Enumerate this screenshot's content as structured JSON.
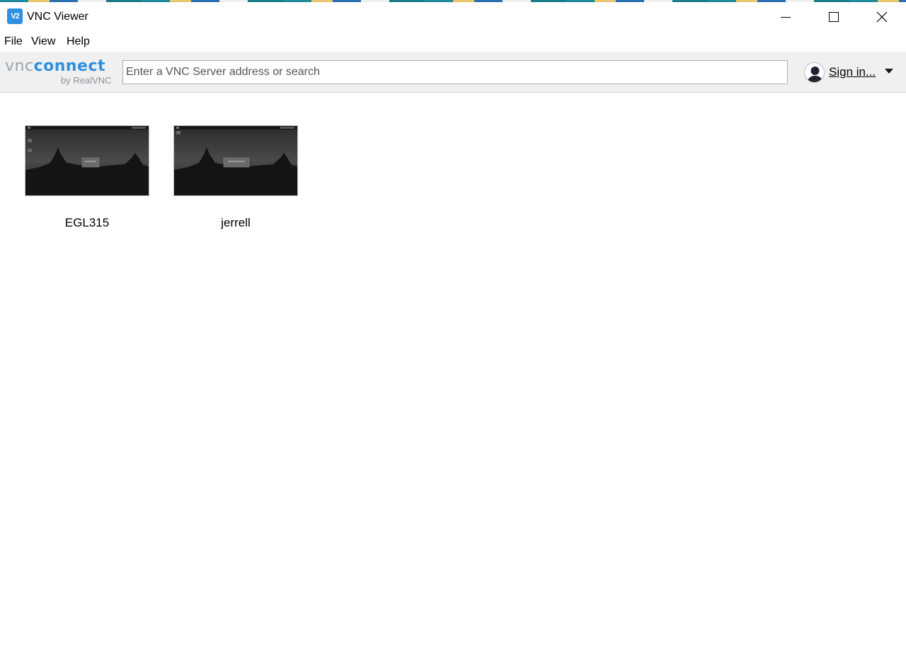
{
  "window": {
    "title": "VNC Viewer",
    "app_icon_text": "V2"
  },
  "menu": {
    "items": [
      "File",
      "View",
      "Help"
    ]
  },
  "toolbar": {
    "logo_vnc": "vnc",
    "logo_connect": "connect",
    "logo_sub": "by RealVNC",
    "search_placeholder": "Enter a VNC Server address or search",
    "signin_label": "Sign in..."
  },
  "connections": [
    {
      "name": "EGL315"
    },
    {
      "name": "jerrell"
    }
  ],
  "colors": {
    "accent": "#2f8fe0",
    "toolbar_bg": "#f0f0f0"
  }
}
